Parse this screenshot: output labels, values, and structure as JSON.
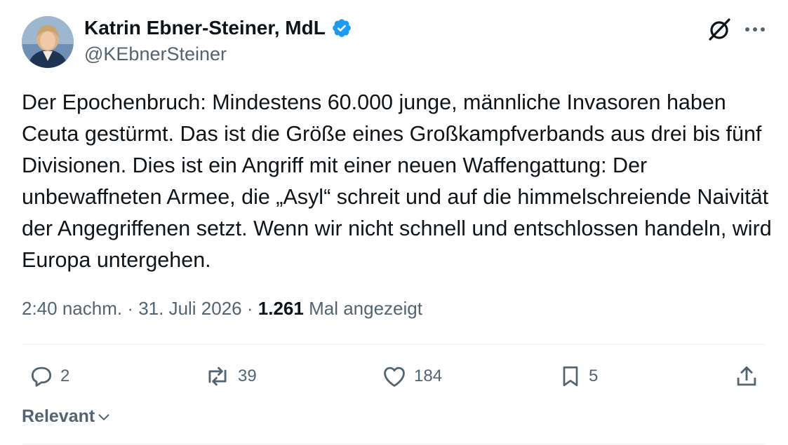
{
  "author": {
    "display_name": "Katrin Ebner-Steiner, MdL",
    "handle": "@KEbnerSteiner",
    "verified": true
  },
  "tweet": {
    "text": "Der Epochenbruch: Mindestens 60.000 junge, männliche Invasoren haben Ceuta gestürmt. Das ist die Größe eines Großkampfverbands aus drei bis fünf Divisionen. Dies ist ein Angriff mit einer neuen Waffengattung: Der unbewaffneten Armee, die „Asyl“ schreit und auf die himmelschreiende Naivität der Angegriffenen setzt. Wenn wir nicht schnell und entschlossen handeln, wird Europa untergehen.",
    "time": "2:40 nachm.",
    "separator": " · ",
    "date": "31. Juli 2026",
    "views": "1.261",
    "views_label": "Mal angezeigt"
  },
  "actions": {
    "replies": "2",
    "reposts": "39",
    "likes": "184",
    "bookmarks": "5"
  },
  "sort": {
    "label": "Relevant"
  },
  "icons": {
    "verified": "verified-badge-icon",
    "grok": "grok-icon",
    "more": "more-icon",
    "reply": "reply-icon",
    "repost": "repost-icon",
    "like": "heart-icon",
    "bookmark": "bookmark-icon",
    "share": "share-icon",
    "chevron": "chevron-down-icon"
  },
  "colors": {
    "verified": "#1d9bf0",
    "text": "#0f1419",
    "secondary": "#536471",
    "divider": "#eff3f4"
  }
}
